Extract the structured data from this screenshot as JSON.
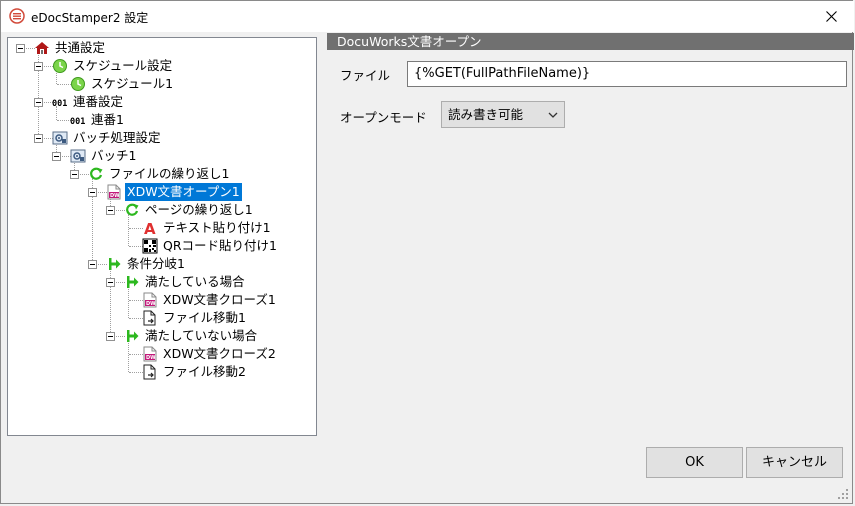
{
  "window": {
    "title": "eDocStamper2 設定"
  },
  "tree": [
    {
      "label": "共通設定",
      "icon": "house-icon",
      "level": 0,
      "expanded": true
    },
    {
      "label": "スケジュール設定",
      "icon": "clock-icon",
      "level": 1,
      "expanded": true
    },
    {
      "label": "スケジュール1",
      "icon": "clock-icon",
      "level": 2
    },
    {
      "label": "連番設定",
      "icon": "numbering-icon",
      "level": 1,
      "expanded": true
    },
    {
      "label": "連番1",
      "icon": "numbering-icon",
      "level": 2
    },
    {
      "label": "バッチ処理設定",
      "icon": "batch-icon",
      "level": 1,
      "expanded": true
    },
    {
      "label": "バッチ1",
      "icon": "batch-icon",
      "level": 2,
      "expanded": true
    },
    {
      "label": "ファイルの繰り返し1",
      "icon": "loop-icon",
      "level": 3,
      "expanded": true
    },
    {
      "label": "XDW文書オープン1",
      "icon": "xdw-document-icon",
      "level": 4,
      "expanded": true,
      "selected": true
    },
    {
      "label": "ページの繰り返し1",
      "icon": "loop-icon",
      "level": 5,
      "expanded": true
    },
    {
      "label": "テキスト貼り付け1",
      "icon": "text-stamp-icon",
      "level": 6
    },
    {
      "label": "QRコード貼り付け1",
      "icon": "qrcode-icon",
      "level": 6
    },
    {
      "label": "条件分岐1",
      "icon": "branch-icon",
      "level": 4,
      "expanded": true
    },
    {
      "label": "満たしている場合",
      "icon": "branch-icon",
      "level": 5,
      "expanded": true
    },
    {
      "label": "XDW文書クローズ1",
      "icon": "xdw-document-icon",
      "level": 6
    },
    {
      "label": "ファイル移動1",
      "icon": "file-move-icon",
      "level": 6
    },
    {
      "label": "満たしていない場合",
      "icon": "branch-icon",
      "level": 5,
      "expanded": true
    },
    {
      "label": "XDW文書クローズ2",
      "icon": "xdw-document-icon",
      "level": 6
    },
    {
      "label": "ファイル移動2",
      "icon": "file-move-icon",
      "level": 6
    }
  ],
  "panel": {
    "header": "DocuWorks文書オープン",
    "file_label": "ファイル",
    "file_value": "{%GET(FullPathFileName)}",
    "open_mode_label": "オープンモード",
    "open_mode_value": "読み書き可能"
  },
  "buttons": {
    "ok": "OK",
    "cancel": "キャンセル"
  },
  "colors": {
    "selection": "#0078d7",
    "section_header": "#707070",
    "window_bg": "#f0f0f0"
  }
}
